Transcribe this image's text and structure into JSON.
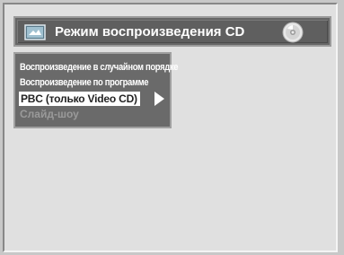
{
  "header": {
    "title": "Режим воспроизведения CD",
    "icon": "screen-icon",
    "disc_icon": "cd-disc-icon"
  },
  "menu": {
    "items": [
      {
        "label": "Воспроизведение в случайном порядке",
        "state": "normal"
      },
      {
        "label": "Воспроизведение по программе",
        "state": "normal"
      },
      {
        "label": "PBC (только Video CD)",
        "state": "selected"
      },
      {
        "label": "Слайд-шоу",
        "state": "disabled"
      }
    ],
    "submenu_arrow_icon": "arrow-right-icon"
  },
  "colors": {
    "background": "#e0e0e0",
    "panel": "#6a6a6a",
    "highlight": "#ffffff",
    "disabled_text": "#9a9a9a"
  }
}
